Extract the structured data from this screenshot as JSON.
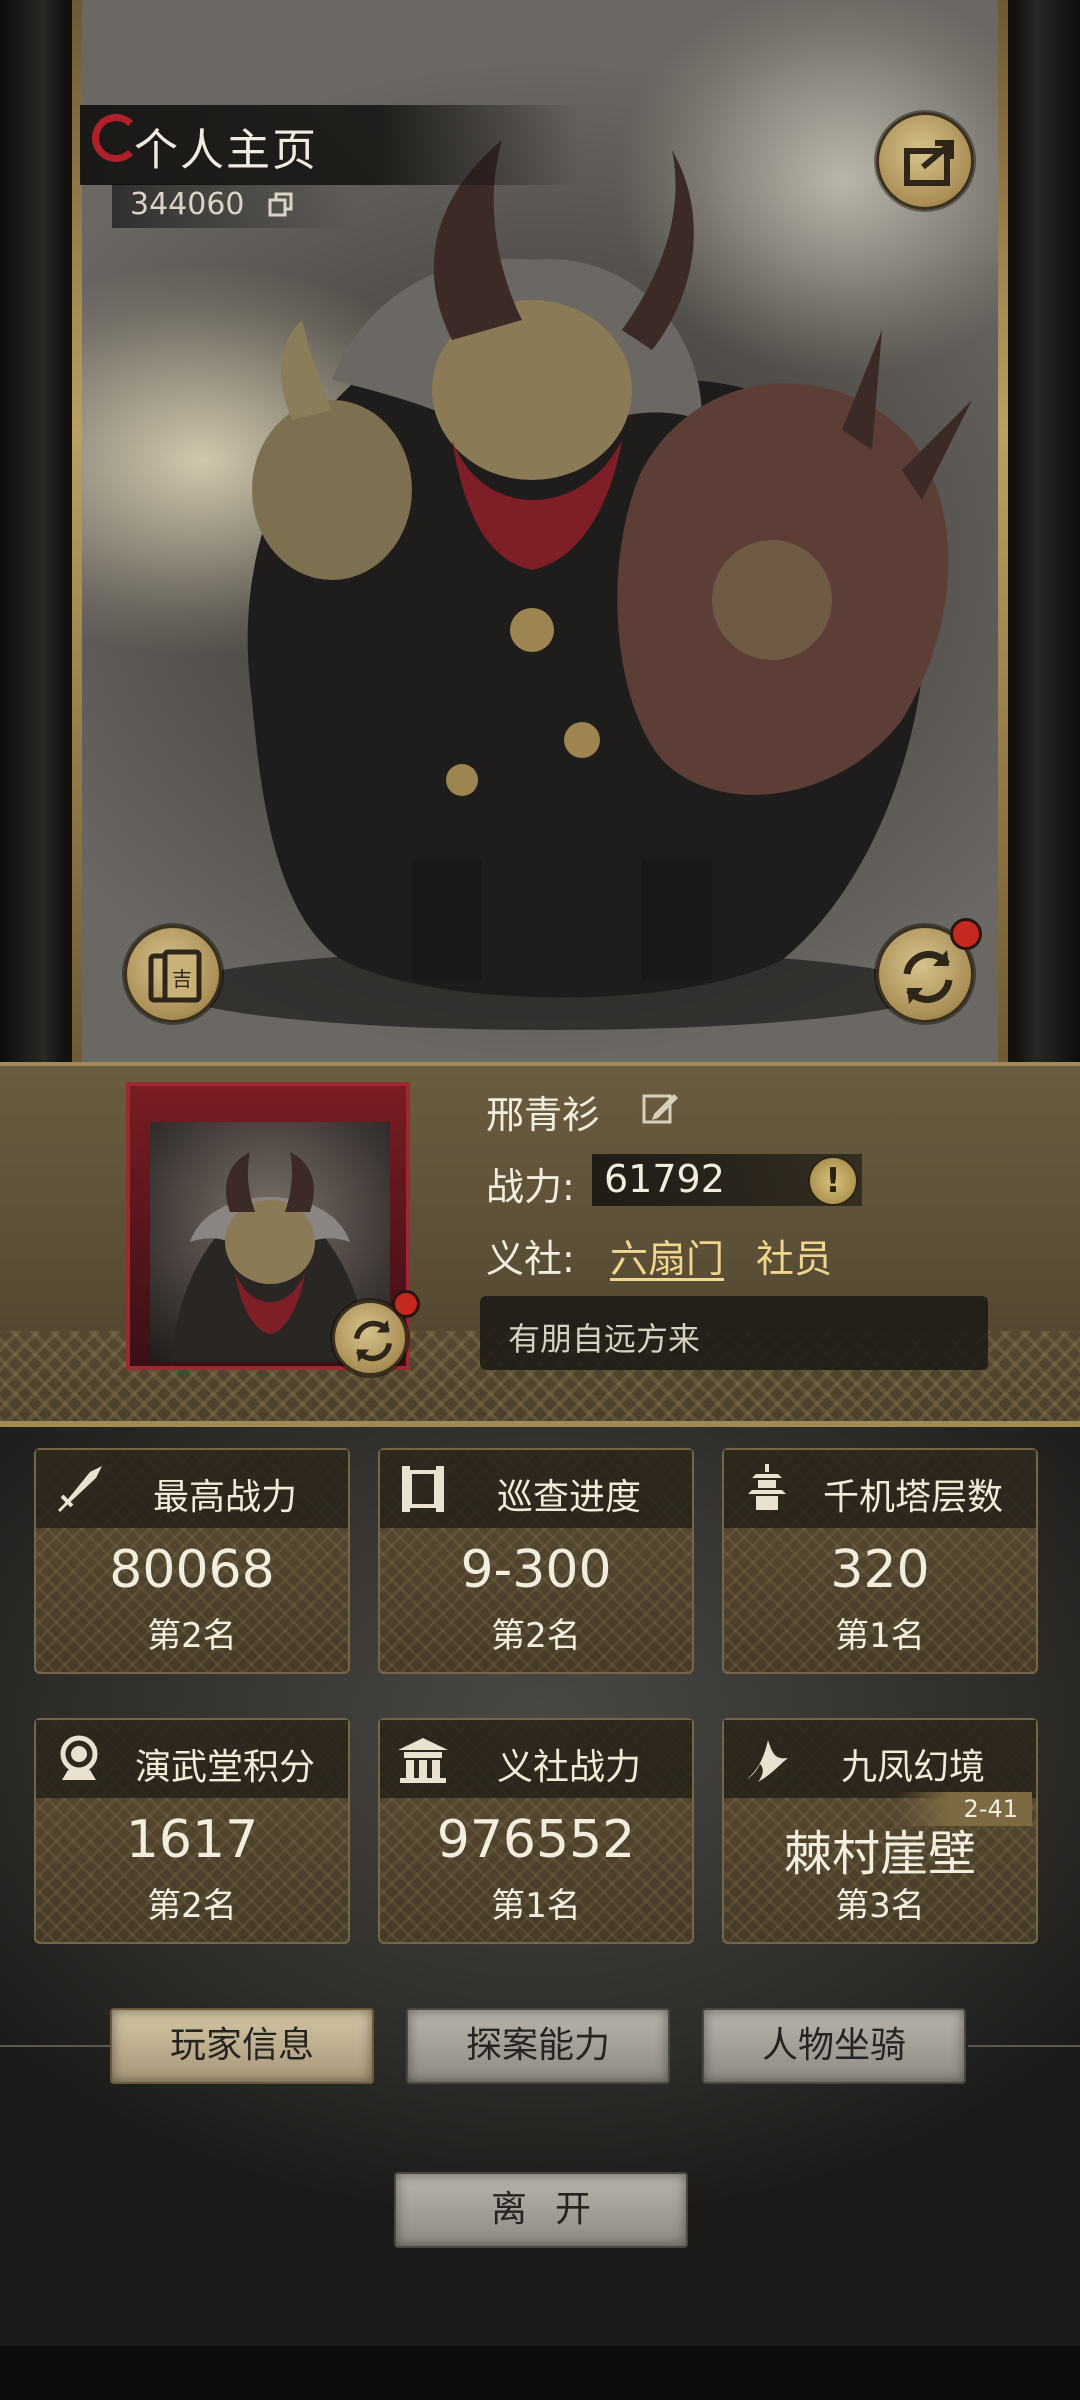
{
  "header": {
    "title": "个人主页",
    "uid": "344060"
  },
  "profile": {
    "name": "邢青衫",
    "power_label": "战力:",
    "power_value": "61792",
    "guild_label": "义社:",
    "guild_name": "六扇门",
    "guild_role": "社员",
    "motto": "有朋自远方来"
  },
  "stats": [
    {
      "title": "最高战力",
      "value": "80068",
      "rank": "第2名",
      "icon": "sword-icon"
    },
    {
      "title": "巡查进度",
      "value": "9-300",
      "rank": "第2名",
      "icon": "scroll-icon"
    },
    {
      "title": "千机塔层数",
      "value": "320",
      "rank": "第1名",
      "icon": "pagoda-icon"
    },
    {
      "title": "演武堂积分",
      "value": "1617",
      "rank": "第2名",
      "icon": "medal-icon"
    },
    {
      "title": "义社战力",
      "value": "976552",
      "rank": "第1名",
      "icon": "hall-icon"
    },
    {
      "title": "九凤幻境",
      "value": "棘村崖壁",
      "rank": "第3名",
      "tag": "2-41",
      "icon": "phoenix-icon"
    }
  ],
  "tabs": [
    {
      "label": "玩家信息",
      "active": true
    },
    {
      "label": "探案能力",
      "active": false
    },
    {
      "label": "人物坐骑",
      "active": false
    }
  ],
  "leave_label": "离开",
  "colors": {
    "accent_gold": "#f0d78c",
    "panel_brown": "#5d5038",
    "notify_red": "#c4281e"
  }
}
